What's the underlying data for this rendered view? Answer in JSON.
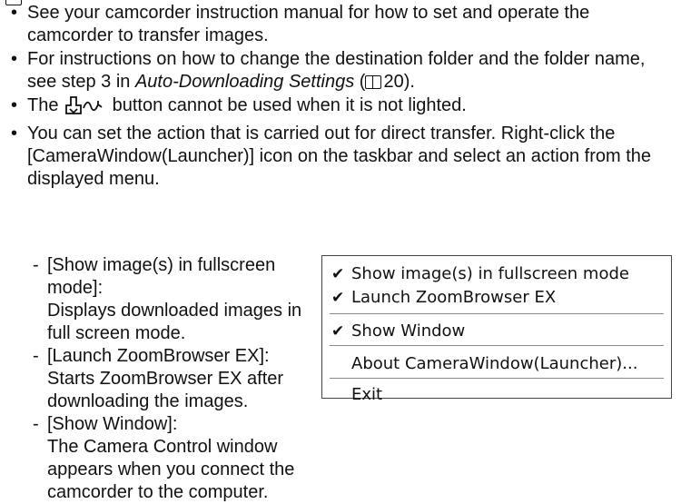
{
  "bullets": [
    {
      "marker": "•",
      "text": "See your camcorder instruction manual for how to set and operate the camcorder to transfer images."
    },
    {
      "marker": "•",
      "pre": "For instructions on how to change the destination folder and the folder name, see step 3 in ",
      "italic": "Auto-Downloading Settings",
      "mid": " (",
      "page_ref": "20",
      "post": ")."
    },
    {
      "marker": "•",
      "pre": "The ",
      "post": " button cannot be used when it is not lighted."
    },
    {
      "marker": "•",
      "text": "You can set the action that is carried out for direct transfer. Right-click the [CameraWindow(Launcher)] icon on the taskbar and select an action from the displayed menu."
    }
  ],
  "sub_items": [
    {
      "marker": "-",
      "title": "[Show image(s) in fullscreen mode]:",
      "desc": "Displays downloaded images in full screen mode."
    },
    {
      "marker": "-",
      "title": "[Launch ZoomBrowser EX]:",
      "desc": "Starts ZoomBrowser EX after downloading the images."
    },
    {
      "marker": "-",
      "title": "[Show Window]:",
      "desc": "The Camera Control window appears when you connect the camcorder to the computer."
    }
  ],
  "context_menu": {
    "items": [
      {
        "label": "Show image(s) in fullscreen mode",
        "checked": "✔"
      },
      {
        "label": "Launch ZoomBrowser EX",
        "checked": "✔"
      },
      {
        "label": "Show Window",
        "checked": "✔"
      },
      {
        "label": "About CameraWindow(Launcher)...",
        "checked": ""
      },
      {
        "label": "Exit",
        "checked": ""
      }
    ]
  },
  "icons": {
    "page_ref_icon": "book-icon",
    "transfer_button_icon": "print-share-icon",
    "checkmark_icon": "checkmark-icon"
  }
}
